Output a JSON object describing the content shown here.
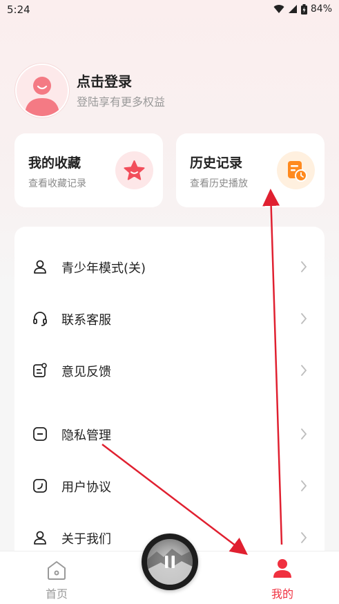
{
  "status_bar": {
    "time": "5:24",
    "battery": "84%"
  },
  "profile": {
    "login_title": "点击登录",
    "login_subtitle": "登陆享有更多权益"
  },
  "cards": [
    {
      "title": "我的收藏",
      "subtitle": "查看收藏记录",
      "icon": "star-icon",
      "color": "#f24e5b"
    },
    {
      "title": "历史记录",
      "subtitle": "查看历史播放",
      "icon": "history-icon",
      "color": "#ff8a1f"
    }
  ],
  "menu": {
    "items": [
      {
        "label": "青少年模式(关)",
        "icon": "youth-mode-icon"
      },
      {
        "label": "联系客服",
        "icon": "headset-icon"
      },
      {
        "label": "意见反馈",
        "icon": "feedback-icon"
      },
      {
        "label": "隐私管理",
        "icon": "privacy-icon"
      },
      {
        "label": "用户协议",
        "icon": "agreement-icon"
      },
      {
        "label": "关于我们",
        "icon": "about-icon"
      }
    ]
  },
  "tabbar": {
    "home_label": "首页",
    "mine_label": "我的",
    "active_color": "#f0303f",
    "inactive_color": "#999999"
  },
  "annotation_color": "#e02030"
}
